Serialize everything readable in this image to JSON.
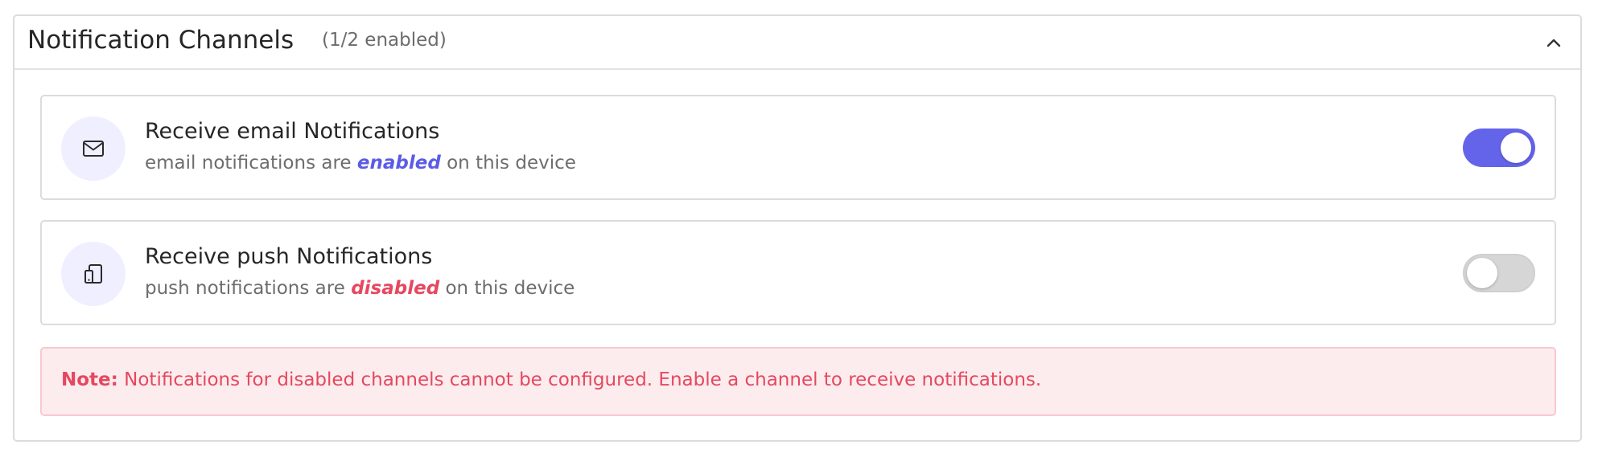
{
  "panel": {
    "title": "Notification Channels",
    "count": "(1/2 enabled)",
    "collapse_icon": "chevron-up-icon"
  },
  "channels": [
    {
      "icon": "mail-icon",
      "title": "Receive email Notifications",
      "desc_prefix": "email notifications are",
      "state_text": "enabled",
      "desc_suffix": "on this device",
      "enabled": true
    },
    {
      "icon": "device-icon",
      "title": "Receive push Notifications",
      "desc_prefix": "push notifications are",
      "state_text": "disabled",
      "desc_suffix": "on this device",
      "enabled": false
    }
  ],
  "note": {
    "label": "Note:",
    "text": "Notifications for disabled channels cannot be configured. Enable a channel to receive notifications."
  },
  "colors": {
    "accent": "#6464ea",
    "enabled_text": "#5b5be6",
    "disabled_text": "#e5485f",
    "note_bg": "#fdecee"
  }
}
